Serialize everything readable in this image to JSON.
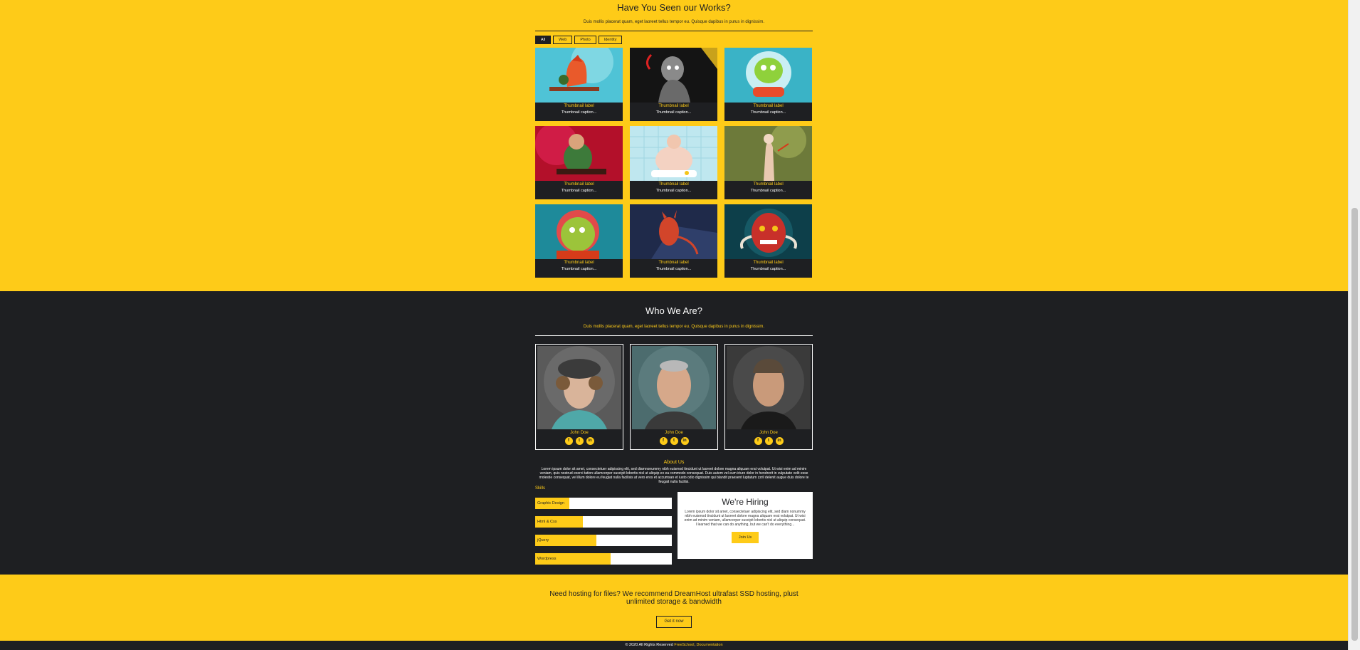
{
  "works": {
    "title": "Have You Seen our Works?",
    "subtitle": "Duis mollis placerat quam, eget laoreet tellus tempor eu. Quisque dapibus in purus in dignissim.",
    "filters": [
      "All",
      "Web",
      "Photo",
      "Identity"
    ],
    "active_filter": "All",
    "items": [
      {
        "label": "Thumbnail label",
        "caption": "Thumbnail caption..."
      },
      {
        "label": "Thumbnail label",
        "caption": "Thumbnail caption..."
      },
      {
        "label": "Thumbnail label",
        "caption": "Thumbnail caption..."
      },
      {
        "label": "Thumbnail label",
        "caption": "Thumbnail caption..."
      },
      {
        "label": "Thumbnail label",
        "caption": "Thumbnail caption..."
      },
      {
        "label": "Thumbnail label",
        "caption": "Thumbnail caption..."
      },
      {
        "label": "Thumbnail label",
        "caption": "Thumbnail caption..."
      },
      {
        "label": "Thumbnail label",
        "caption": "Thumbnail caption..."
      },
      {
        "label": "Thumbnail label",
        "caption": "Thumbnail caption..."
      }
    ]
  },
  "who": {
    "title": "Who We Are?",
    "subtitle": "Duis mollis placerat quam, eget laoreet tellus tempor eu. Quisque dapibus in purus in dignissim.",
    "members": [
      {
        "name": "John Doe"
      },
      {
        "name": "John Doe"
      },
      {
        "name": "John Doe"
      }
    ],
    "social_icons": [
      "facebook-icon",
      "twitter-icon",
      "linkedin-icon"
    ],
    "social_glyphs": [
      "f",
      "t",
      "in"
    ],
    "about_title": "About Us",
    "about_text": "Lorem ipsum dolor sit amet, consectetuer adipiscing elit, sed diamnonummy nibh euismod tincidunt ut laoreet dolore magna aliquam erat volutpat. Ut wisi enim ad minim veniam, quis nostrud exerci tation ullamcorper suscipit lobortis nisl ut aliquip ex ea commodo consequat. Duis autem vel eum iriure dolor in hendrerit in vulputate velit esse molestie consequat, vel illum dolore eu feugiat nulla facilisis at vero eros et accumsan et iusto odio dignissim qui blandit praesent luptatum zzril delenit augue duis dolore te feugait nulla facilisi.",
    "skills_title": "Skills",
    "skills": [
      {
        "name": "Graphic Design",
        "level": 0.25
      },
      {
        "name": "Html & Css",
        "level": 0.35
      },
      {
        "name": "jQuery",
        "level": 0.45
      },
      {
        "name": "Wordpress",
        "level": 0.55
      }
    ],
    "hiring": {
      "title": "We're Hiring",
      "text": "Lorem ipsum dolor sit amet, consectetuer adipiscing elit, sed diam nonummy nibh euismod tincidunt ut laoreet dolore magna aliquam erat volutpat. Ut wisi enim ad minim veniam, ullamcorper suscipit lobortis nisl ut aliquip consequat. I learned that we can do anything, but we can't do everything...",
      "button": "Join Us"
    }
  },
  "hosting": {
    "text": "Need hosting for files? We recommend DreamHost ultrafast SSD hosting, plust unlimited storage & bandwidth",
    "button": "Get it now"
  },
  "footer": {
    "text": "© 2020 All Rights Reserved",
    "link1": "FreeSchool",
    "separator": ",",
    "link2": "Documentation"
  },
  "colors": {
    "accent": "#fecb18",
    "dark": "#1e1f22"
  }
}
